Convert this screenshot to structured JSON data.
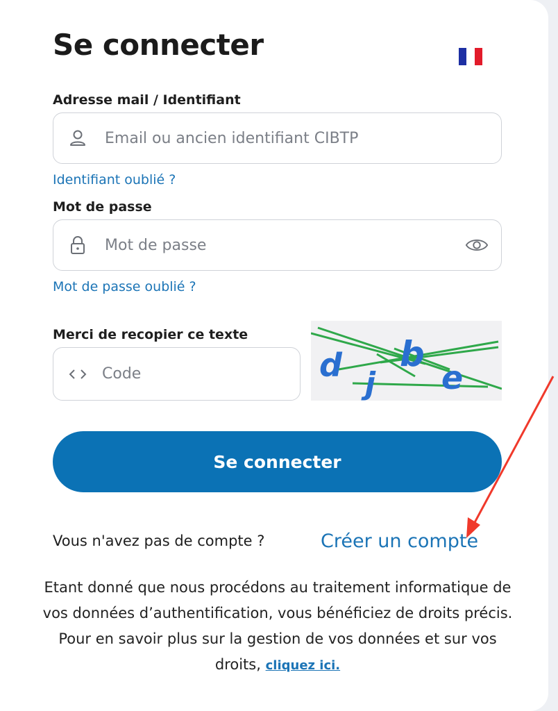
{
  "title": "Se connecter",
  "colors": {
    "accent": "#0b72b5",
    "link": "#1b74b6",
    "flag_blue": "#1d2fa3",
    "flag_white": "#ffffff",
    "flag_red": "#e21b2a",
    "annotation_arrow": "#f0392b"
  },
  "email": {
    "label": "Adresse mail / Identifiant",
    "placeholder": "Email ou ancien identifiant CIBTP",
    "icon": "user-icon",
    "forgot_link": "Identifiant oublié ?"
  },
  "password": {
    "label": "Mot de passe",
    "placeholder": "Mot de passe",
    "icon": "lock-icon",
    "toggle_icon": "eye-icon",
    "forgot_link": "Mot de passe oublié ?"
  },
  "captcha": {
    "label": "Merci de recopier ce texte",
    "placeholder": "Code",
    "icon": "code-icon",
    "chars": [
      "d",
      "j",
      "b",
      "e"
    ]
  },
  "submit_label": "Se connecter",
  "signup": {
    "prompt": "Vous n'avez pas de compte ?",
    "link": "Créer un compte"
  },
  "legal": {
    "text": "Etant donné que nous procédons au traitement informatique de vos données d’authentification, vous bénéficiez de droits précis. Pour en savoir plus sur la gestion de vos données et sur vos droits,",
    "link": "cliquez ici."
  }
}
